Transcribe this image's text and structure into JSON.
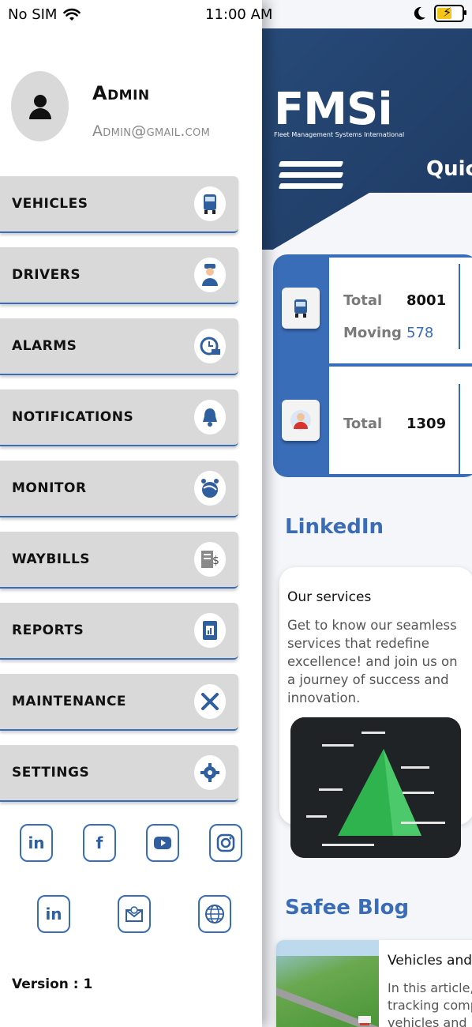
{
  "status_bar": {
    "carrier": "No SIM",
    "time": "11:00 AM"
  },
  "drawer": {
    "user": {
      "name": "Admin",
      "email": "Admin@gmail.com"
    },
    "menu": [
      {
        "label": "VEHICLES",
        "icon": "truck-icon"
      },
      {
        "label": "DRIVERS",
        "icon": "driver-icon"
      },
      {
        "label": "ALARMS",
        "icon": "alarm-clock-icon"
      },
      {
        "label": "NOTIFICATIONS",
        "icon": "bell-icon"
      },
      {
        "label": "MONITOR",
        "icon": "monitor-globe-icon"
      },
      {
        "label": "WAYBILLS",
        "icon": "invoice-icon"
      },
      {
        "label": "REPORTS",
        "icon": "report-icon"
      },
      {
        "label": "MAINTENANCE",
        "icon": "tools-icon"
      },
      {
        "label": "SETTINGS",
        "icon": "gear-icon"
      }
    ],
    "social_row1": [
      "in",
      "f",
      "youtube",
      "instagram"
    ],
    "social_row2": [
      "in",
      "mail",
      "web"
    ],
    "version": "Version : 1"
  },
  "main": {
    "logo": "FMSi",
    "logo_sub": "Fleet Management Systems International",
    "quick_label": "Quick",
    "vehicles": {
      "total_label": "Total",
      "total_value": "8001",
      "moving_label": "Moving",
      "moving_value": "578"
    },
    "drivers": {
      "total_label": "Total",
      "total_value": "1309"
    },
    "linkedin_title": "LinkedIn",
    "post": {
      "title": "Our services",
      "body": "Get to know our seamless services that redefine excellence! and join us on a journey of success and innovation."
    },
    "blog_title": "Safee Blog",
    "blog": {
      "title": "Vehicles and T",
      "body_lines": [
        "In this article,",
        "tracking comp",
        "vehicles and lo"
      ]
    },
    "colors": {
      "accent": "#3a6db8",
      "header": "#274a77",
      "menu_bg": "#d9d9d9"
    }
  }
}
